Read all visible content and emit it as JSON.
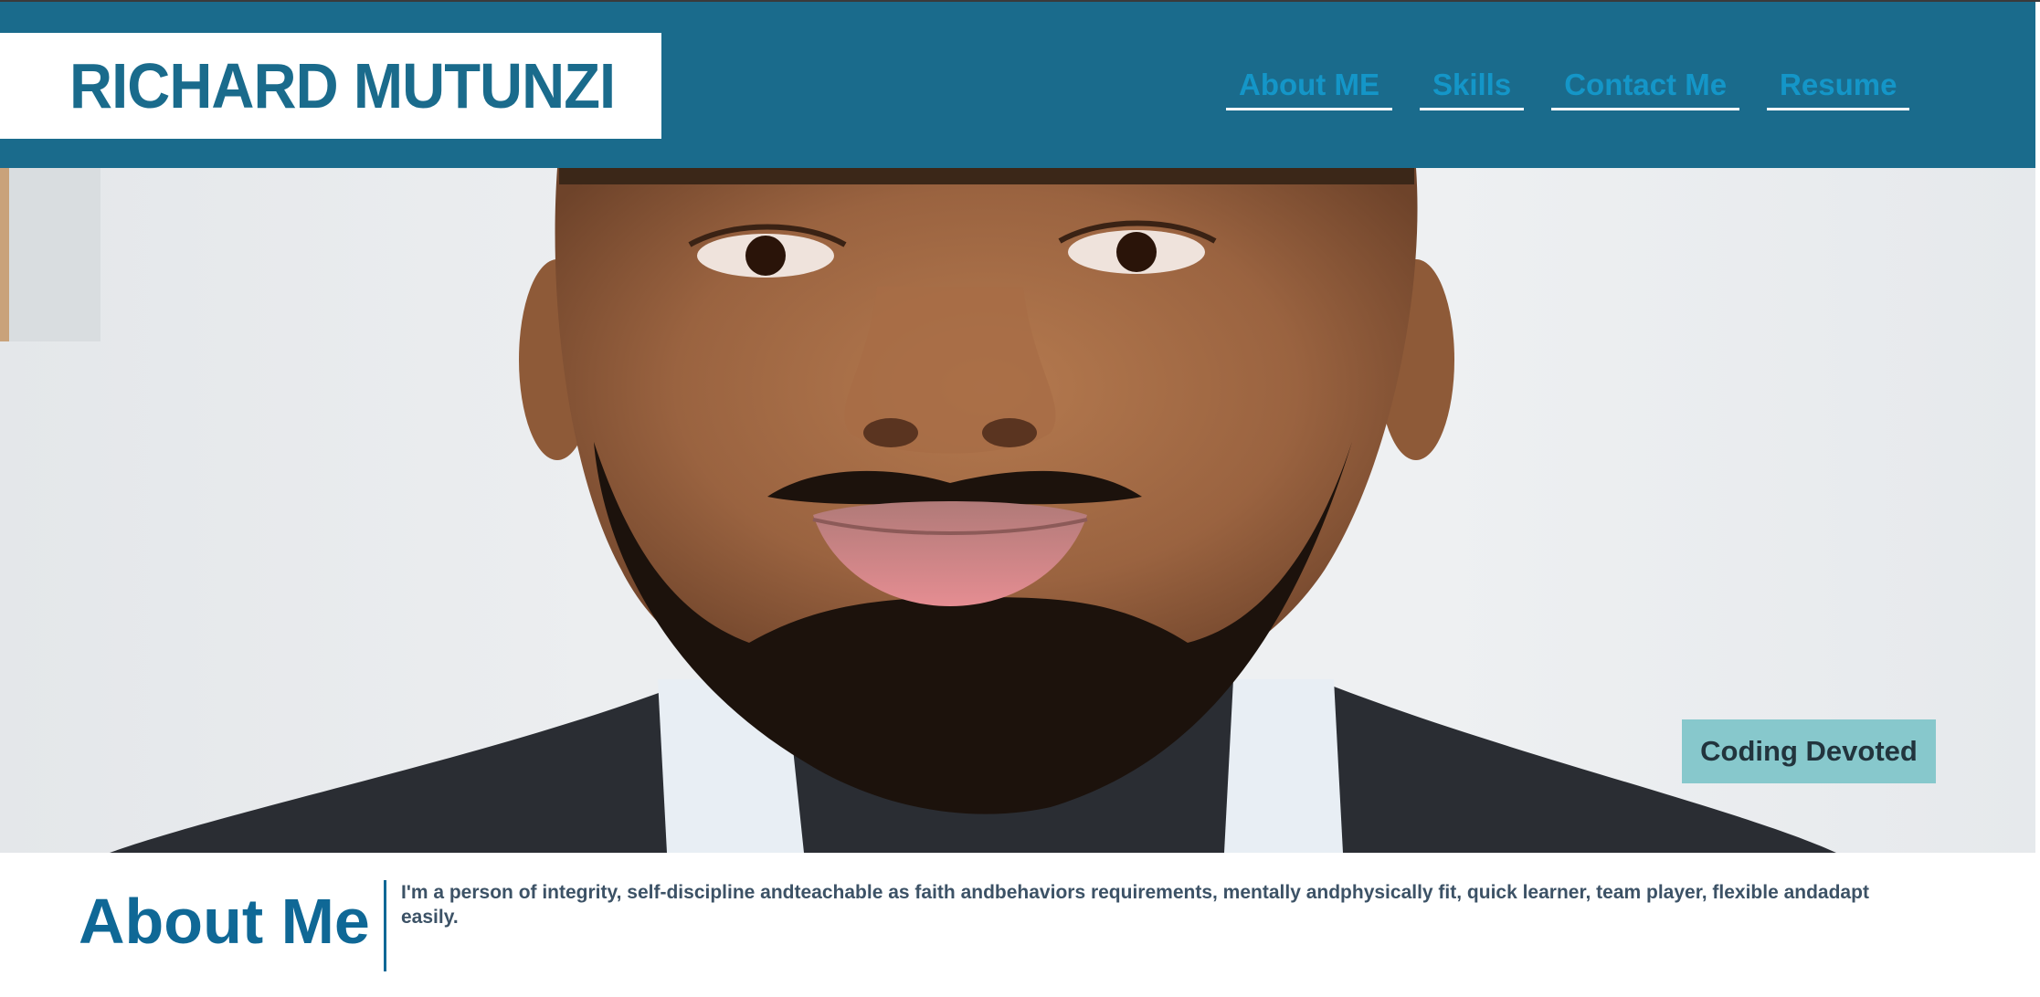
{
  "header": {
    "brand": "RICHARD MUTUNZI",
    "nav": [
      {
        "label": "About ME"
      },
      {
        "label": "Skills"
      },
      {
        "label": "Contact Me"
      },
      {
        "label": "Resume"
      }
    ]
  },
  "hero": {
    "tagline": "Coding Devoted"
  },
  "about": {
    "heading": "About Me",
    "text": "I'm a person of integrity, self-discipline andteachable as faith andbehaviors requirements, mentally andphysically fit, quick learner, team player, flexible andadapt easily."
  },
  "colors": {
    "header_bg": "#1a6b8c",
    "brand_text": "#1a6b8c",
    "nav_link": "#1496c8",
    "tagline_bg": "#87c8cc",
    "about_heading": "#0f6896",
    "about_text": "#3c5266"
  }
}
